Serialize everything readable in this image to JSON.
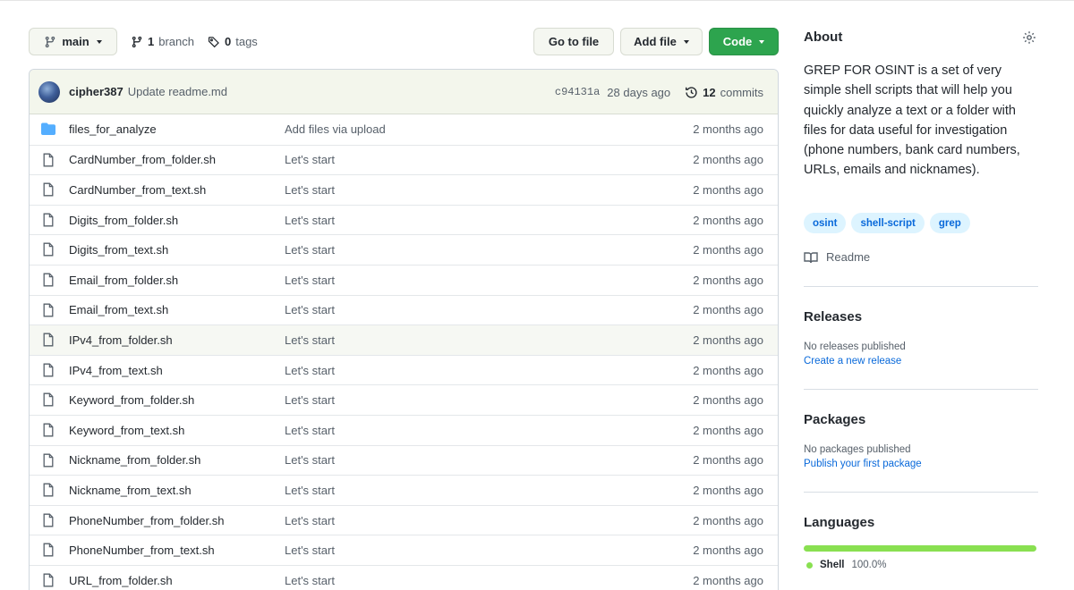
{
  "toolbar": {
    "branch_name": "main",
    "branches_count": "1",
    "branches_label": "branch",
    "tags_count": "0",
    "tags_label": "tags",
    "go_to_file_label": "Go to file",
    "add_file_label": "Add file",
    "code_label": "Code"
  },
  "commit": {
    "author": "cipher387",
    "message": "Update readme.md",
    "sha": "c94131a",
    "age": "28 days ago",
    "commits_count": "12",
    "commits_label": "commits"
  },
  "files": [
    {
      "name": "files_for_analyze",
      "message": "Add files via upload",
      "age": "2 months ago",
      "type": "folder"
    },
    {
      "name": "CardNumber_from_folder.sh",
      "message": "Let's start",
      "age": "2 months ago",
      "type": "file"
    },
    {
      "name": "CardNumber_from_text.sh",
      "message": "Let's start",
      "age": "2 months ago",
      "type": "file"
    },
    {
      "name": "Digits_from_folder.sh",
      "message": "Let's start",
      "age": "2 months ago",
      "type": "file"
    },
    {
      "name": "Digits_from_text.sh",
      "message": "Let's start",
      "age": "2 months ago",
      "type": "file"
    },
    {
      "name": "Email_from_folder.sh",
      "message": "Let's start",
      "age": "2 months ago",
      "type": "file"
    },
    {
      "name": "Email_from_text.sh",
      "message": "Let's start",
      "age": "2 months ago",
      "type": "file"
    },
    {
      "name": "IPv4_from_folder.sh",
      "message": "Let's start",
      "age": "2 months ago",
      "type": "file"
    },
    {
      "name": "IPv4_from_text.sh",
      "message": "Let's start",
      "age": "2 months ago",
      "type": "file"
    },
    {
      "name": "Keyword_from_folder.sh",
      "message": "Let's start",
      "age": "2 months ago",
      "type": "file"
    },
    {
      "name": "Keyword_from_text.sh",
      "message": "Let's start",
      "age": "2 months ago",
      "type": "file"
    },
    {
      "name": "Nickname_from_folder.sh",
      "message": "Let's start",
      "age": "2 months ago",
      "type": "file"
    },
    {
      "name": "Nickname_from_text.sh",
      "message": "Let's start",
      "age": "2 months ago",
      "type": "file"
    },
    {
      "name": "PhoneNumber_from_folder.sh",
      "message": "Let's start",
      "age": "2 months ago",
      "type": "file"
    },
    {
      "name": "PhoneNumber_from_text.sh",
      "message": "Let's start",
      "age": "2 months ago",
      "type": "file"
    },
    {
      "name": "URL_from_folder.sh",
      "message": "Let's start",
      "age": "2 months ago",
      "type": "file"
    }
  ],
  "sidebar": {
    "about_title": "About",
    "description": "GREP FOR OSINT is a set of very simple shell scripts that will help you quickly analyze a text or a folder with files for data useful for investigation (phone numbers, bank card numbers, URLs, emails and nicknames).",
    "topics": [
      "osint",
      "shell-script",
      "grep"
    ],
    "readme_label": "Readme",
    "releases_title": "Releases",
    "releases_empty": "No releases published",
    "releases_link": "Create a new release",
    "packages_title": "Packages",
    "packages_empty": "No packages published",
    "packages_link": "Publish your first package",
    "languages_title": "Languages",
    "language_name": "Shell",
    "language_percent": "100.0%",
    "language_share": 1.0,
    "language_color": "#89e051"
  },
  "colors": {
    "accent_green": "#2da44e",
    "link_blue": "#0969da",
    "folder_blue": "#54aeff"
  }
}
